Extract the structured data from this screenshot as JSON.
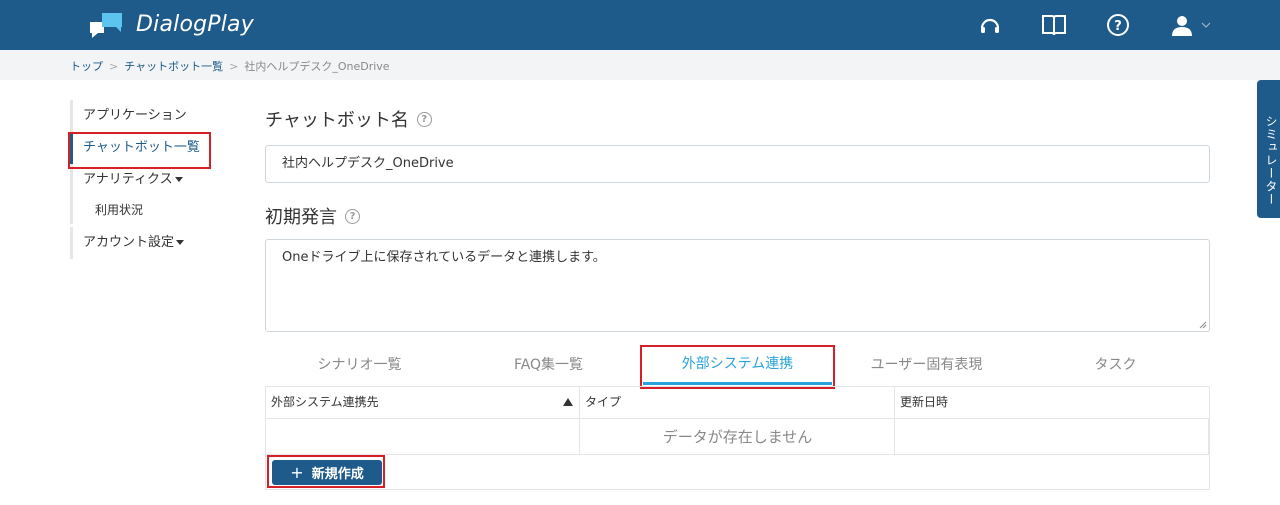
{
  "header": {
    "app_name": "DialogPlay",
    "icons": [
      "headset-icon",
      "book-icon",
      "help-icon",
      "user-icon",
      "chevron-down-icon"
    ]
  },
  "breadcrumb": {
    "items": [
      "トップ",
      "チャットボット一覧"
    ],
    "current": "社内ヘルプデスク_OneDrive"
  },
  "sidenav": {
    "application": "アプリケーション",
    "chatbot_list": "チャットボット一覧",
    "analytics": "アナリティクス",
    "usage": "利用状況",
    "account_settings": "アカウント設定"
  },
  "form": {
    "name_label": "チャットボット名",
    "name_value": "社内ヘルプデスク_OneDrive",
    "initial_label": "初期発言",
    "initial_value": "Oneドライブ上に保存されているデータと連携します。"
  },
  "tabs": {
    "scenario": "シナリオ一覧",
    "faq": "FAQ集一覧",
    "external": "外部システム連携",
    "user_expr": "ユーザー固有表現",
    "task": "タスク"
  },
  "table": {
    "columns": [
      "外部システム連携先",
      "タイプ",
      "更新日時"
    ],
    "empty_message": "データが存在しません",
    "new_button": "新規作成"
  },
  "simulator": {
    "label": "シミュレーター"
  },
  "colors": {
    "header": "#1e5a8a",
    "accent": "#29a3d9",
    "highlight": "#d62028"
  }
}
